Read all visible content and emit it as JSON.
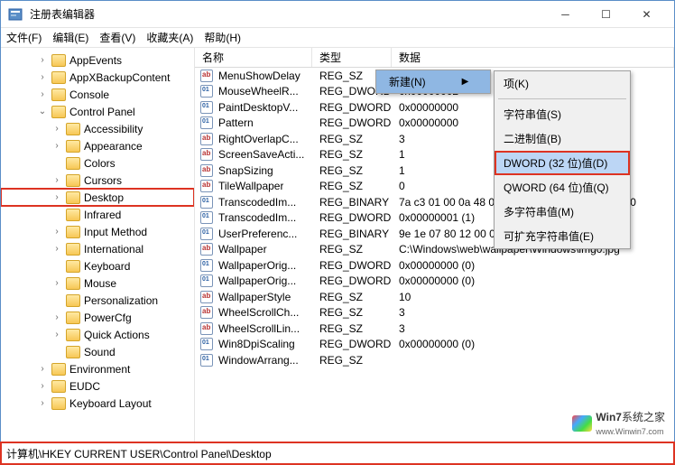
{
  "window": {
    "title": "注册表编辑器"
  },
  "menu": {
    "file": "文件(F)",
    "edit": "编辑(E)",
    "view": "查看(V)",
    "fav": "收藏夹(A)",
    "help": "帮助(H)"
  },
  "tree": [
    {
      "ind": 40,
      "tw": ">",
      "label": "AppEvents"
    },
    {
      "ind": 40,
      "tw": ">",
      "label": "AppXBackupContent"
    },
    {
      "ind": 40,
      "tw": ">",
      "label": "Console"
    },
    {
      "ind": 40,
      "tw": "v",
      "label": "Control Panel"
    },
    {
      "ind": 56,
      "tw": ">",
      "label": "Accessibility"
    },
    {
      "ind": 56,
      "tw": ">",
      "label": "Appearance"
    },
    {
      "ind": 56,
      "tw": "",
      "label": "Colors"
    },
    {
      "ind": 56,
      "tw": ">",
      "label": "Cursors"
    },
    {
      "ind": 56,
      "tw": ">",
      "label": "Desktop",
      "hl": true
    },
    {
      "ind": 56,
      "tw": "",
      "label": "Infrared"
    },
    {
      "ind": 56,
      "tw": ">",
      "label": "Input Method"
    },
    {
      "ind": 56,
      "tw": ">",
      "label": "International"
    },
    {
      "ind": 56,
      "tw": "",
      "label": "Keyboard"
    },
    {
      "ind": 56,
      "tw": ">",
      "label": "Mouse"
    },
    {
      "ind": 56,
      "tw": "",
      "label": "Personalization"
    },
    {
      "ind": 56,
      "tw": ">",
      "label": "PowerCfg"
    },
    {
      "ind": 56,
      "tw": ">",
      "label": "Quick Actions"
    },
    {
      "ind": 56,
      "tw": "",
      "label": "Sound"
    },
    {
      "ind": 40,
      "tw": ">",
      "label": "Environment"
    },
    {
      "ind": 40,
      "tw": ">",
      "label": "EUDC"
    },
    {
      "ind": 40,
      "tw": ">",
      "label": "Keyboard Layout"
    }
  ],
  "cols": {
    "name": "名称",
    "type": "类型",
    "data": "数据"
  },
  "rows": [
    {
      "ic": "sz",
      "name": "MenuShowDelay",
      "type": "REG_SZ",
      "data": ""
    },
    {
      "ic": "bin",
      "name": "MouseWheelR...",
      "type": "REG_DWORD",
      "data": "0x00000002"
    },
    {
      "ic": "bin",
      "name": "PaintDesktopV...",
      "type": "REG_DWORD",
      "data": "0x00000000"
    },
    {
      "ic": "bin",
      "name": "Pattern",
      "type": "REG_DWORD",
      "data": "0x00000000"
    },
    {
      "ic": "sz",
      "name": "RightOverlapC...",
      "type": "REG_SZ",
      "data": "3"
    },
    {
      "ic": "sz",
      "name": "ScreenSaveActi...",
      "type": "REG_SZ",
      "data": "1"
    },
    {
      "ic": "sz",
      "name": "SnapSizing",
      "type": "REG_SZ",
      "data": "1"
    },
    {
      "ic": "sz",
      "name": "TileWallpaper",
      "type": "REG_SZ",
      "data": "0"
    },
    {
      "ic": "bin",
      "name": "TranscodedIm...",
      "type": "REG_BINARY",
      "data": "7a c3 01 00 0a 48 01 00 00 00 40 00 00 00 03 00"
    },
    {
      "ic": "bin",
      "name": "TranscodedIm...",
      "type": "REG_DWORD",
      "data": "0x00000001 (1)"
    },
    {
      "ic": "bin",
      "name": "UserPreferenc...",
      "type": "REG_BINARY",
      "data": "9e 1e 07 80 12 00 00 00"
    },
    {
      "ic": "sz",
      "name": "Wallpaper",
      "type": "REG_SZ",
      "data": "C:\\Windows\\web\\wallpaper\\Windows\\img0.jpg"
    },
    {
      "ic": "bin",
      "name": "WallpaperOrig...",
      "type": "REG_DWORD",
      "data": "0x00000000 (0)"
    },
    {
      "ic": "bin",
      "name": "WallpaperOrig...",
      "type": "REG_DWORD",
      "data": "0x00000000 (0)"
    },
    {
      "ic": "sz",
      "name": "WallpaperStyle",
      "type": "REG_SZ",
      "data": "10"
    },
    {
      "ic": "sz",
      "name": "WheelScrollCh...",
      "type": "REG_SZ",
      "data": "3"
    },
    {
      "ic": "sz",
      "name": "WheelScrollLin...",
      "type": "REG_SZ",
      "data": "3"
    },
    {
      "ic": "bin",
      "name": "Win8DpiScaling",
      "type": "REG_DWORD",
      "data": "0x00000000 (0)"
    },
    {
      "ic": "bin",
      "name": "WindowArrang...",
      "type": "REG_SZ",
      "data": ""
    }
  ],
  "context": {
    "new": "新建(N)",
    "items": [
      {
        "label": "项(K)"
      },
      {
        "label": "字符串值(S)"
      },
      {
        "label": "二进制值(B)"
      },
      {
        "label": "DWORD (32 位)值(D)",
        "sel": true,
        "box": true
      },
      {
        "label": "QWORD (64 位)值(Q)"
      },
      {
        "label": "多字符串值(M)"
      },
      {
        "label": "可扩充字符串值(E)"
      }
    ]
  },
  "status": "计算机\\HKEY CURRENT USER\\Control Panel\\Desktop",
  "watermark": {
    "brand": "Win7",
    "text": "系统之家",
    "url": "www.Winwin7.com"
  }
}
